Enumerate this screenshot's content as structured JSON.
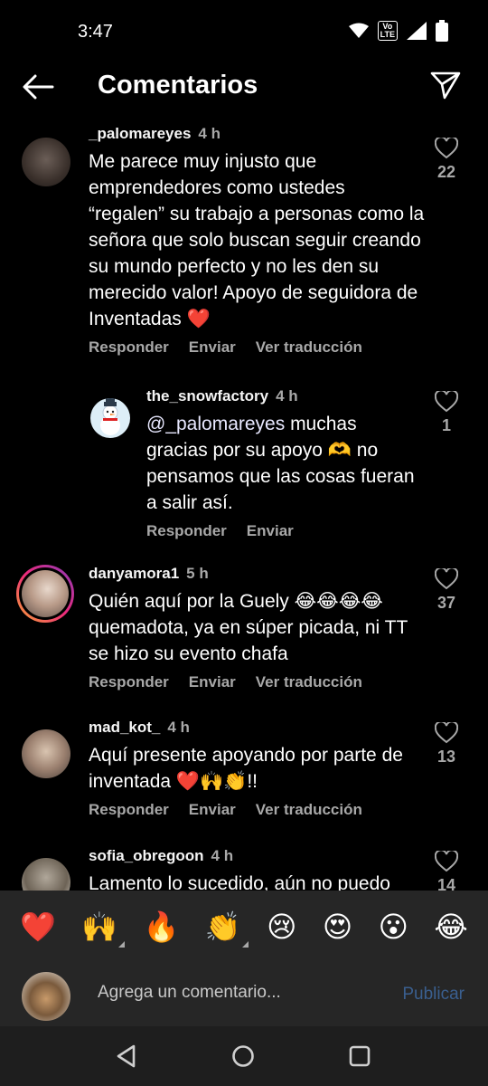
{
  "status": {
    "time": "3:47",
    "volte": "Vo\nLTE"
  },
  "header": {
    "title": "Comentarios"
  },
  "comments": [
    {
      "user": "_palomareyes",
      "time": "4 h",
      "text": "Me parece muy injusto que emprendedores como ustedes “regalen” su trabajo a personas como la señora que solo buscan seguir creando su mundo perfecto y no les den su merecido valor! Apoyo de seguidora de Inventadas ❤️",
      "likes": "22",
      "reply": "Responder",
      "send": "Enviar",
      "translate": "Ver traducción"
    },
    {
      "user": "the_snowfactory",
      "time": "4 h",
      "mention": "@_palomareyes",
      "text": " muchas gracias por su apoyo 🫶 no pensamos que las cosas fueran a salir así.",
      "likes": "1",
      "reply": "Responder",
      "send": "Enviar"
    },
    {
      "user": "danyamora1",
      "time": "5 h",
      "text": "Quién aquí por la Guely 😂😂😂😂 quemadota, ya en súper picada, ni TT se hizo su evento chafa",
      "likes": "37",
      "reply": "Responder",
      "send": "Enviar",
      "translate": "Ver traducción"
    },
    {
      "user": "mad_kot_",
      "time": "4 h",
      "text": "Aquí presente apoyando por parte de inventada ❤️🙌👏!!",
      "likes": "13",
      "reply": "Responder",
      "send": "Enviar",
      "translate": "Ver traducción"
    },
    {
      "user": "sofia_obregoon",
      "time": "4 h",
      "text": "Lamento lo sucedido, aún no puedo",
      "likes": "14"
    }
  ],
  "emojis": [
    "❤️",
    "🙌",
    "🔥",
    "👏",
    "😢",
    "😍",
    "😮",
    "😂"
  ],
  "composer": {
    "placeholder": "Agrega un comentario...",
    "publish": "Publicar"
  }
}
